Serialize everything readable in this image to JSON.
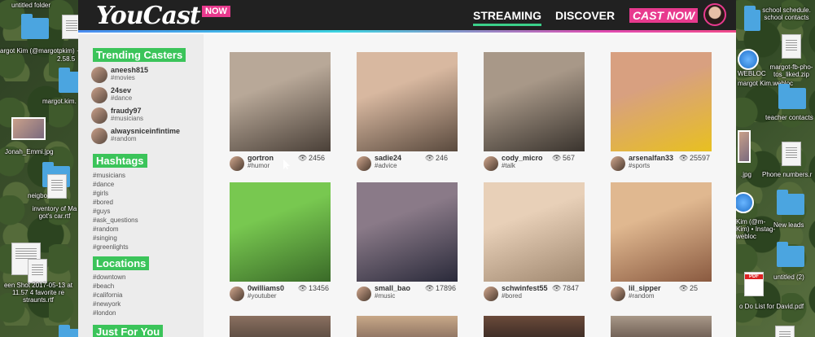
{
  "desktop": {
    "left_items": [
      {
        "label": "untitled folder"
      },
      {
        "label": "argot Kim (@margotpkim) · Twitter files"
      },
      {
        "label": "2.58.5"
      },
      {
        "label": "margot.kim."
      },
      {
        "label": "Jonah_Emmi.jpg"
      },
      {
        "label": "neigbo"
      },
      {
        "label": "inventory of Ma got's car.rtf"
      },
      {
        "label": "een Shot 2017-05-13 at 11.57 4 favorite re straunts.rtf"
      }
    ],
    "right_items": [
      {
        "label": "school schedule. school contacts"
      },
      {
        "label": "WEBLOC"
      },
      {
        "label": "margot-fb-pho-tos_liked.zip"
      },
      {
        "label": "margot Kim.webloc"
      },
      {
        "label": "teacher contacts"
      },
      {
        "label": ".jpg"
      },
      {
        "label": "Phone numbers.r"
      },
      {
        "label": "Kim (@m-Kim) • Instag-webloc"
      },
      {
        "label": "New leads"
      },
      {
        "label": "untitled (2)"
      },
      {
        "label": "o Do List for David.pdf"
      }
    ],
    "pdf_label": "PDF",
    "webloc_label": "WEBLOC"
  },
  "app": {
    "logo": "YouCast",
    "logo_badge": "NOW",
    "nav": {
      "streaming": "STREAMING",
      "discover": "DISCOVER",
      "cast_now": "CAST NOW"
    },
    "sidebar": {
      "trending_title": "Trending Casters",
      "casters": [
        {
          "name": "aneesh815",
          "tag": "#movies"
        },
        {
          "name": "24sev",
          "tag": "#dance"
        },
        {
          "name": "fraudy97",
          "tag": "#musicians"
        },
        {
          "name": "alwaysniceinfintime",
          "tag": "#random"
        }
      ],
      "hashtags_title": "Hashtags",
      "hashtags": [
        "#musicians",
        "#dance",
        "#girls",
        "#bored",
        "#guys",
        "#ask_questions",
        "#random",
        "#singing",
        "#greenlights"
      ],
      "locations_title": "Locations",
      "locations": [
        "#downtown",
        "#beach",
        "#california",
        "#newyork",
        "#london"
      ],
      "just_for_you_title": "Just For You"
    },
    "cards": [
      {
        "user": "gortron",
        "tag": "#humor",
        "views": "2456",
        "c1": "#b8a898",
        "c2": "#4a4038"
      },
      {
        "user": "sadie24",
        "tag": "#advice",
        "views": "246",
        "c1": "#d8b8a0",
        "c2": "#5a4a3e"
      },
      {
        "user": "cody_micro",
        "tag": "#talk",
        "views": "567",
        "c1": "#a89888",
        "c2": "#3a342e"
      },
      {
        "user": "arsenalfan33",
        "tag": "#sports",
        "views": "25597",
        "c1": "#d8a080",
        "c2": "#e8c020"
      },
      {
        "user": "0williams0",
        "tag": "#youtuber",
        "views": "13456",
        "c1": "#78c850",
        "c2": "#3a6a28"
      },
      {
        "user": "small_bao",
        "tag": "#music",
        "views": "17896",
        "c1": "#8a7a88",
        "c2": "#2a2a3a"
      },
      {
        "user": "schwinfest55",
        "tag": "#bored",
        "views": "7847",
        "c1": "#e8d0b8",
        "c2": "#a08870"
      },
      {
        "user": "lil_sipper",
        "tag": "#random",
        "views": "25",
        "c1": "#e0b890",
        "c2": "#8a5a40"
      }
    ]
  }
}
